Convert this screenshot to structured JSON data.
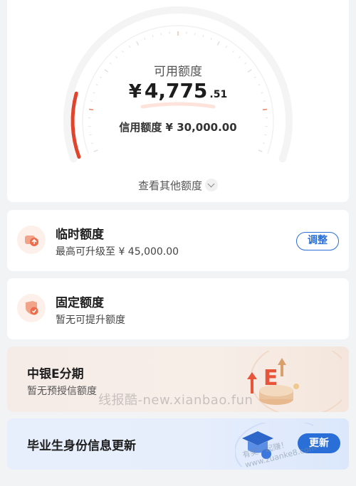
{
  "gauge": {
    "available_label": "可用额度",
    "currency": "¥",
    "available_integer": "4,775",
    "available_decimal": ".51",
    "credit_line_text": "信用额度 ¥ 30,000.00",
    "more_quota_text": "查看其他额度",
    "usage_fraction": 0.16,
    "accent_color": "#e0442c"
  },
  "temporary_quota": {
    "title": "临时额度",
    "subtitle": "最高可升级至  ¥ 45,000.00",
    "adjust_label": "调整",
    "icon": "quota-up-icon"
  },
  "fixed_quota": {
    "title": "固定额度",
    "subtitle": "暂无可提升额度",
    "icon": "shield-quota-icon"
  },
  "installment": {
    "title": "中银E分期",
    "subtitle": "暂无预授信额度",
    "illustration": "e-installment-illustration"
  },
  "graduate": {
    "title": "毕业生身份信息更新",
    "update_label": "更新",
    "illustration": "graduation-cap-illustration"
  },
  "watermarks": {
    "main": "线报酷-new.xianbao.fun",
    "secondary": "有奖一起赚！ www.zuanke8.com"
  }
}
